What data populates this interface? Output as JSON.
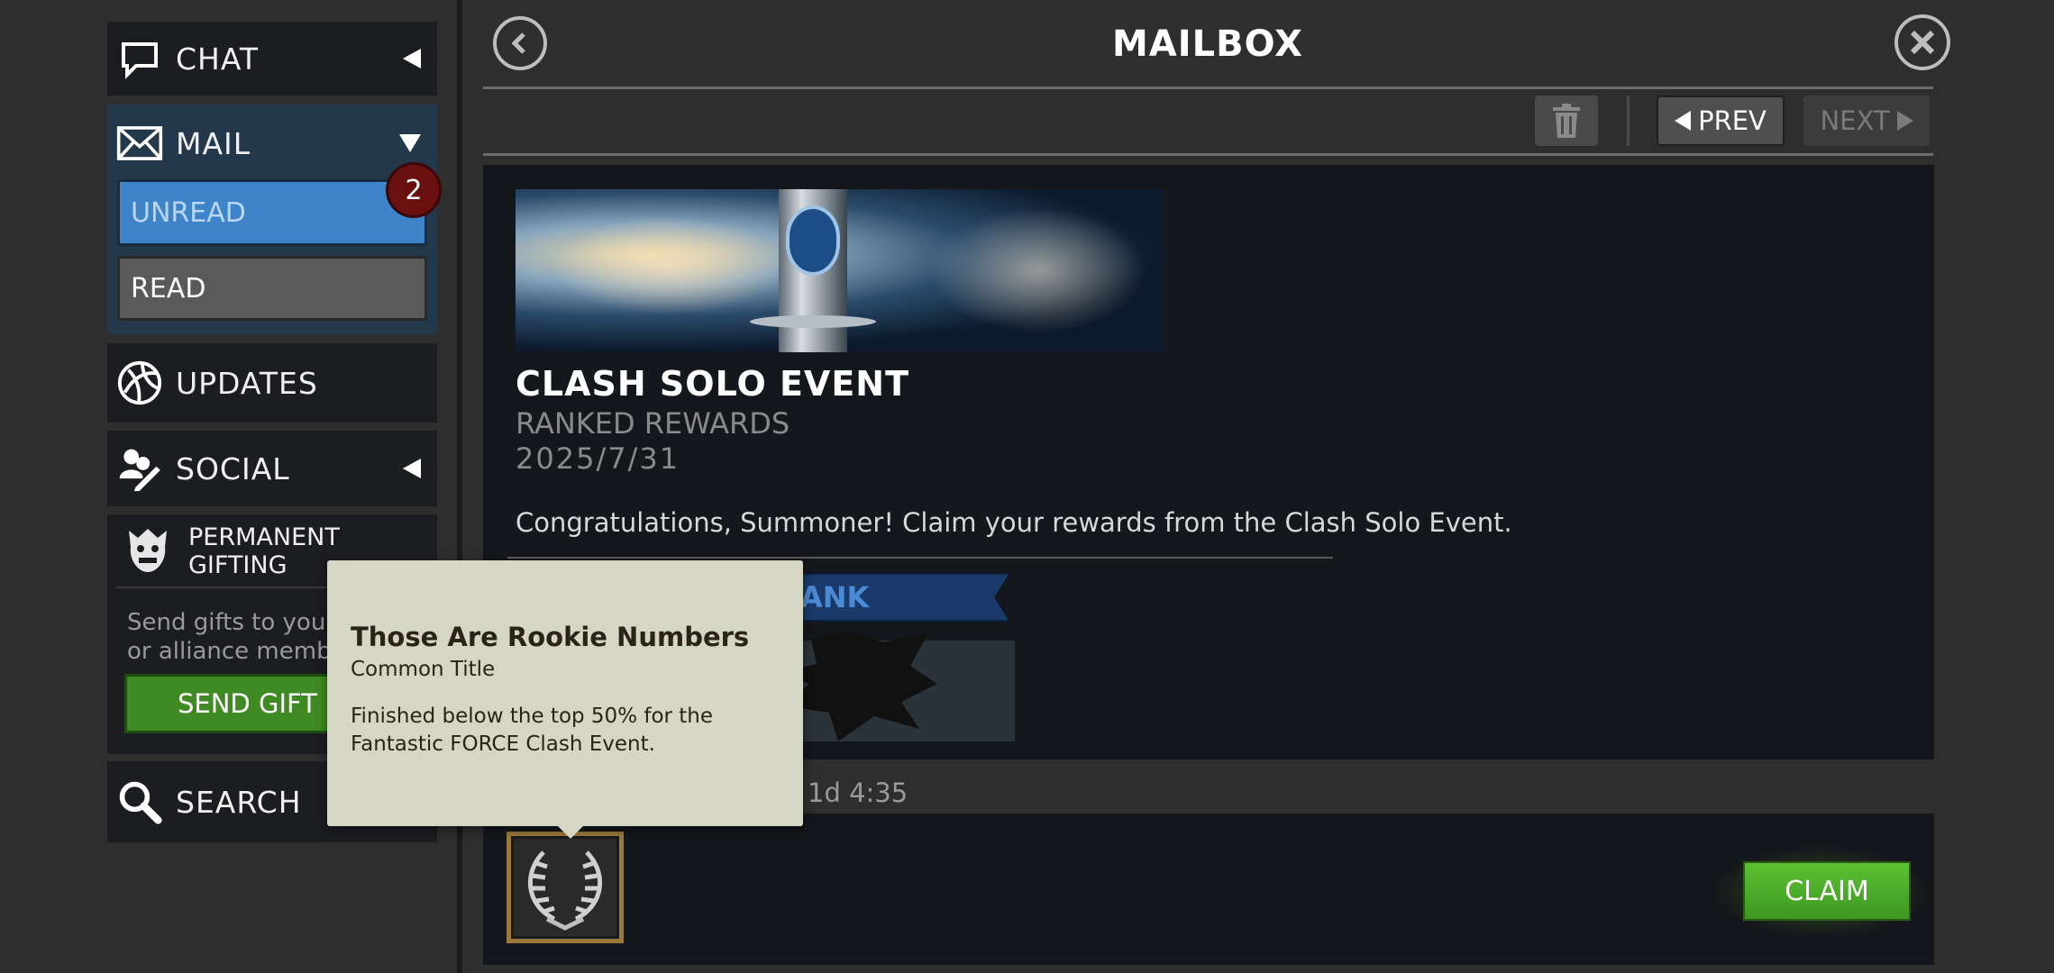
{
  "header": {
    "title": "MAILBOX"
  },
  "sidebar": {
    "chat_label": "CHAT",
    "mail_label": "MAIL",
    "unread_label": "UNREAD",
    "unread_count": "2",
    "read_label": "READ",
    "updates_label": "UPDATES",
    "social_label": "SOCIAL",
    "gifting_title_line1": "PERMANENT",
    "gifting_title_line2": "GIFTING",
    "gifting_desc_line1": "Send gifts to your",
    "gifting_desc_line2": "or alliance memb",
    "send_gifts_label": "SEND GIFT",
    "search_label": "SEARCH"
  },
  "toolbar": {
    "prev_label": "PREV",
    "next_label": "NEXT"
  },
  "message": {
    "title": "CLASH SOLO EVENT",
    "subtitle": "RANKED REWARDS",
    "date": "2025/7/31",
    "body": "Congratulations, Summoner! Claim your rewards from the Clash Solo Event.",
    "rank_banner": "ANK",
    "expiry": "1d 4:35",
    "claim_label": "CLAIM"
  },
  "tooltip": {
    "title": "Those Are Rookie Numbers",
    "rarity": "Common Title",
    "description_line1": "Finished below the top 50% for the",
    "description_line2": "Fantastic FORCE Clash Event."
  },
  "colors": {
    "unread_blue": "#3f84c9",
    "badge_red": "#6b1010",
    "claim_green": "#4caf2a",
    "send_green": "#3f8a22"
  },
  "icons": [
    "chat-icon",
    "mail-icon",
    "updates-icon",
    "social-icon",
    "gifting-icon",
    "search-icon",
    "back-icon",
    "close-icon",
    "trash-icon",
    "laurel-icon"
  ]
}
